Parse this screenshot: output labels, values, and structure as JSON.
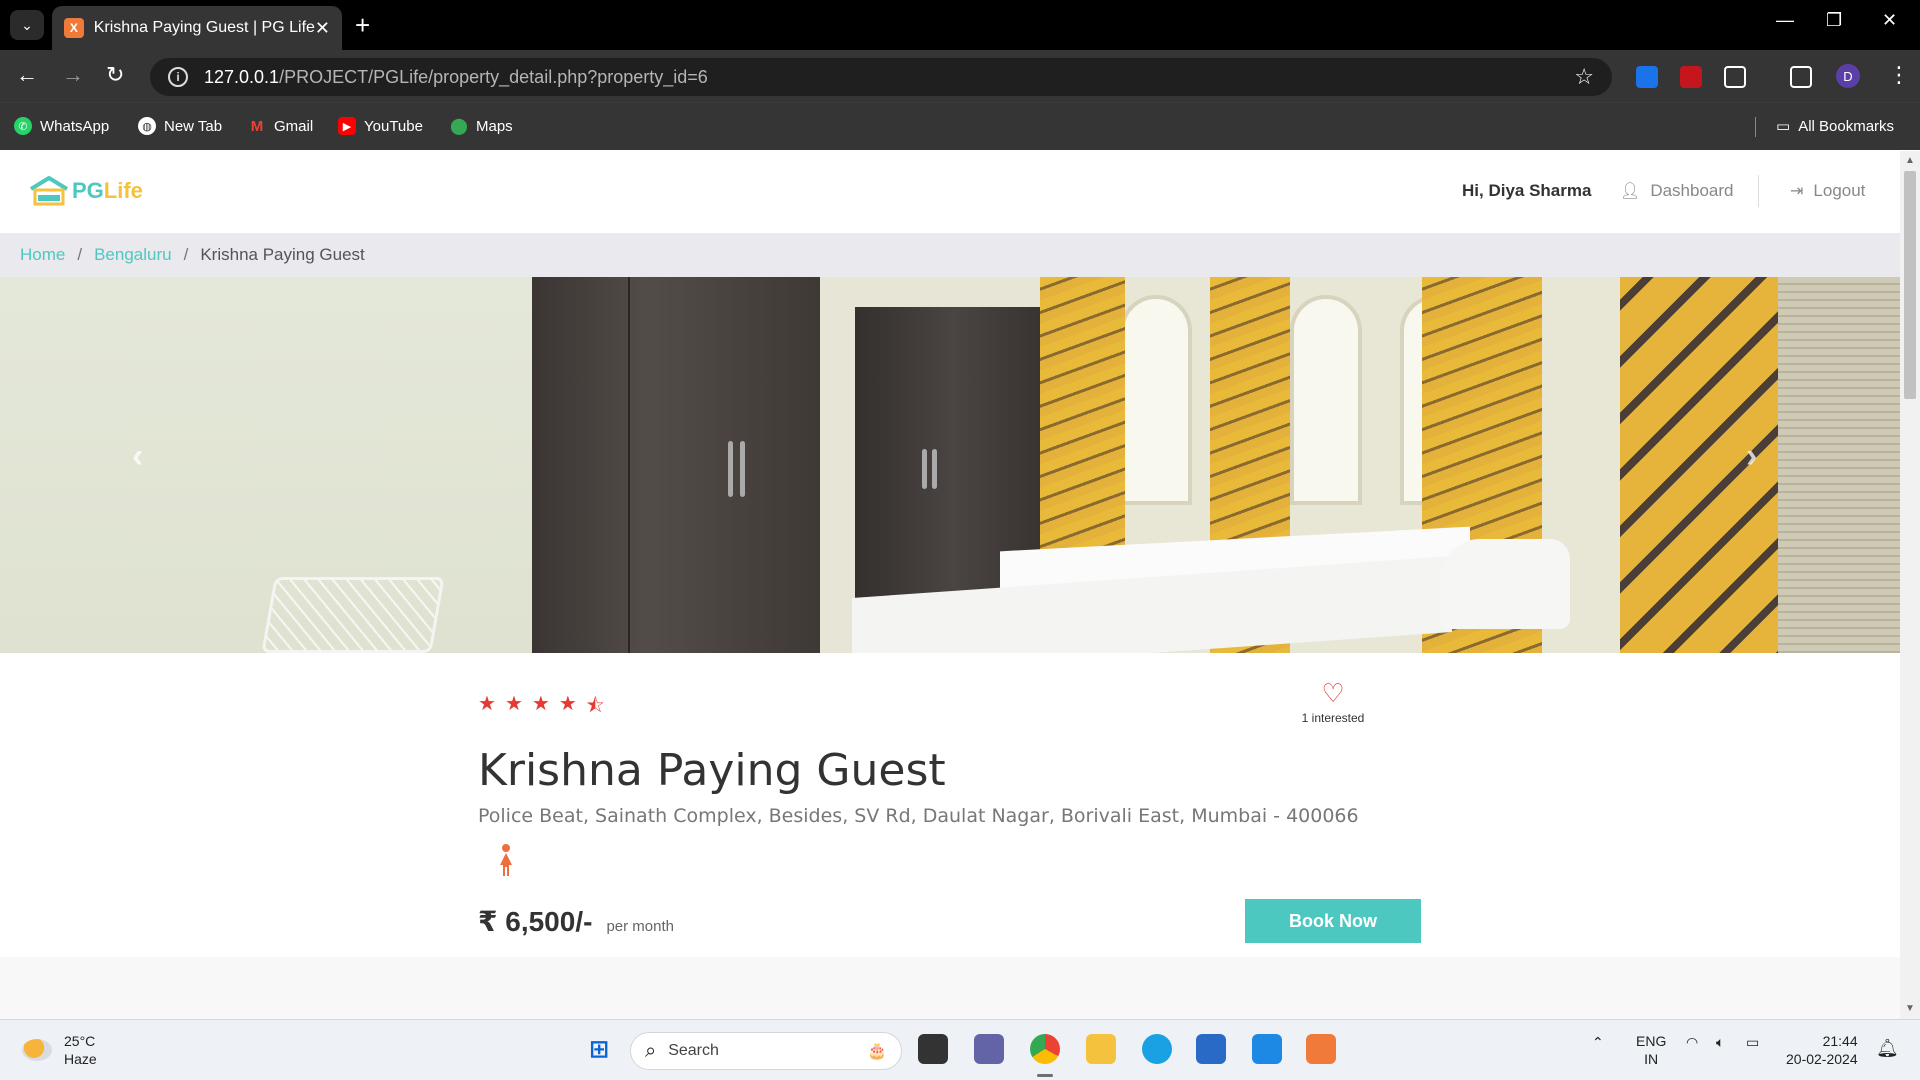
{
  "browser": {
    "tab_title": "Krishna Paying Guest | PG Life",
    "tab_favicon_text": "X",
    "url_host": "127.0.0.1",
    "url_path": "/PROJECT/PGLife/property_detail.php?property_id=6",
    "profile_initial": "D",
    "bookmarks": [
      {
        "label": "WhatsApp",
        "icon": "whatsapp-icon",
        "color": "#25d366"
      },
      {
        "label": "New Tab",
        "icon": "globe-icon",
        "color": "#ffffff"
      },
      {
        "label": "Gmail",
        "icon": "gmail-icon",
        "color": "#ea4335"
      },
      {
        "label": "YouTube",
        "icon": "youtube-icon",
        "color": "#ff0000"
      },
      {
        "label": "Maps",
        "icon": "maps-pin-icon",
        "color": "#34a853"
      }
    ],
    "all_bookmarks_label": "All Bookmarks"
  },
  "site": {
    "logo": {
      "pg": "PG",
      "life": "Life"
    },
    "greeting": "Hi, Diya Sharma",
    "nav": {
      "dashboard": "Dashboard",
      "logout": "Logout"
    },
    "breadcrumb": {
      "home": "Home",
      "city": "Bengaluru",
      "current": "Krishna Paying Guest"
    },
    "carousel": {
      "prev": "‹",
      "next": "›"
    }
  },
  "property": {
    "rating_stars": 4.5,
    "interested_text": "1 interested",
    "name": "Krishna Paying Guest",
    "address": "Police Beat, Sainath Complex, Besides, SV Rd, Daulat Nagar, Borivali East, Mumbai - 400066",
    "gender_icon": "female-icon",
    "rent": "₹ 6,500/-",
    "rent_period": "per month",
    "book_button": "Book Now"
  },
  "colors": {
    "accent": "#4dc8c0",
    "logo_yellow": "#f5c23e",
    "star_red": "#e53935",
    "gender_orange": "#f26d3d"
  },
  "taskbar": {
    "weather_temp": "25°C",
    "weather_desc": "Haze",
    "search_placeholder": "Search",
    "lang_line1": "ENG",
    "lang_line2": "IN",
    "time": "21:44",
    "date": "20-02-2024"
  }
}
